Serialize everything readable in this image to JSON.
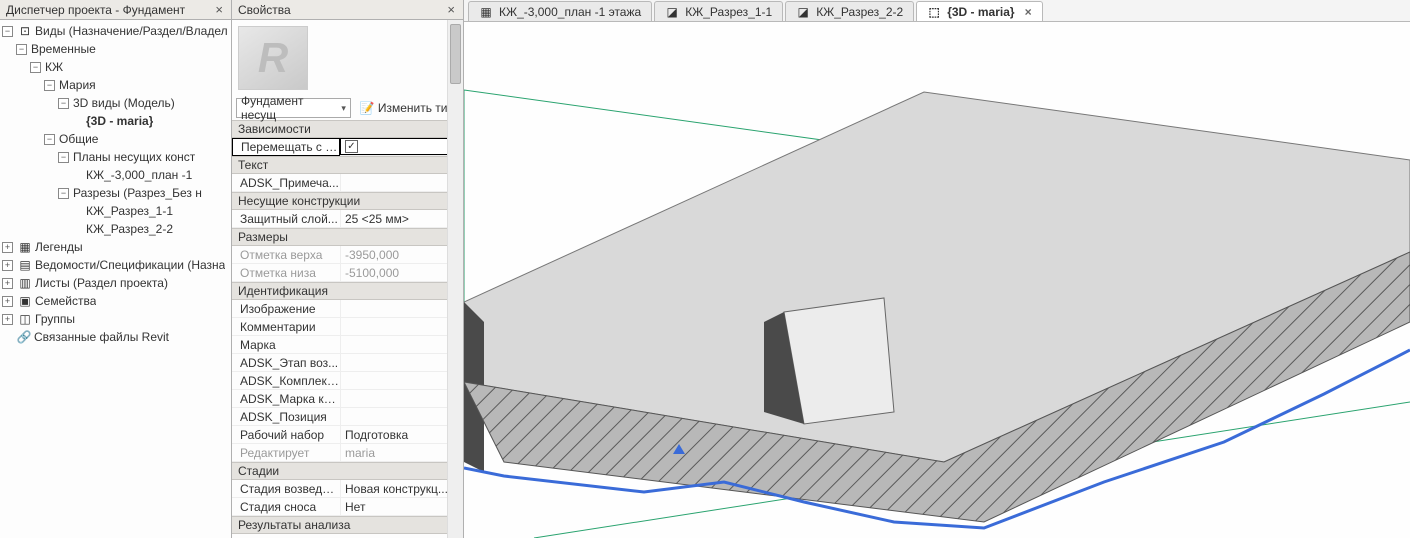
{
  "project_browser": {
    "title": "Диспетчер проекта - Фундамент",
    "root": "Виды (Назначение/Раздел/Владел",
    "temp": "Временные",
    "kzh": "КЖ",
    "maria": "Мария",
    "views3d": "3D виды (Модель)",
    "view3d_maria": "{3D - maria}",
    "common": "Общие",
    "plans": "Планы несущих конст",
    "plan_item": "КЖ_-3,000_план -1",
    "sections": "Разрезы (Разрез_Без н",
    "section1": "КЖ_Разрез_1-1",
    "section2": "КЖ_Разрез_2-2",
    "legends": "Легенды",
    "schedules": "Ведомости/Спецификации (Назна",
    "sheets": "Листы (Раздел проекта)",
    "families": "Семейства",
    "groups": "Группы",
    "links": "Связанные файлы Revit"
  },
  "properties": {
    "title": "Свойства",
    "type_selector": "Фундамент несущ",
    "edit_type": "Изменить тип",
    "groups": {
      "deps": "Зависимости",
      "text": "Текст",
      "struct": "Несущие конструкции",
      "dims": "Размеры",
      "ident": "Идентификация",
      "phases": "Стадии",
      "analysis": "Результаты анализа"
    },
    "rows": {
      "move_with": {
        "n": "Перемещать с с...",
        "v": ""
      },
      "adsk_note": {
        "n": "ADSK_Примеча...",
        "v": ""
      },
      "cover": {
        "n": "Защитный слой...",
        "v": "25 <25 мм>"
      },
      "top": {
        "n": "Отметка верха",
        "v": "-3950,000"
      },
      "bottom": {
        "n": "Отметка низа",
        "v": "-5100,000"
      },
      "image": {
        "n": "Изображение",
        "v": ""
      },
      "comments": {
        "n": "Комментарии",
        "v": ""
      },
      "mark": {
        "n": "Марка",
        "v": ""
      },
      "adsk_stage": {
        "n": "ADSK_Этап воз...",
        "v": ""
      },
      "adsk_set": {
        "n": "ADSK_Комплект ...",
        "v": ""
      },
      "adsk_mark": {
        "n": "ADSK_Марка ко...",
        "v": ""
      },
      "adsk_pos": {
        "n": "ADSK_Позиция",
        "v": ""
      },
      "workset": {
        "n": "Рабочий набор",
        "v": "Подготовка"
      },
      "edited_by": {
        "n": "Редактирует",
        "v": "maria"
      },
      "phase_created": {
        "n": "Стадия возведен...",
        "v": "Новая конструкц..."
      },
      "phase_demo": {
        "n": "Стадия сноса",
        "v": "Нет"
      }
    }
  },
  "tabs": [
    {
      "label": "КЖ_-3,000_план -1 этажа",
      "icon": "grid"
    },
    {
      "label": "КЖ_Разрез_1-1",
      "icon": "section"
    },
    {
      "label": "КЖ_Разрез_2-2",
      "icon": "section"
    },
    {
      "label": "{3D - maria}",
      "icon": "cube",
      "active": true
    }
  ]
}
